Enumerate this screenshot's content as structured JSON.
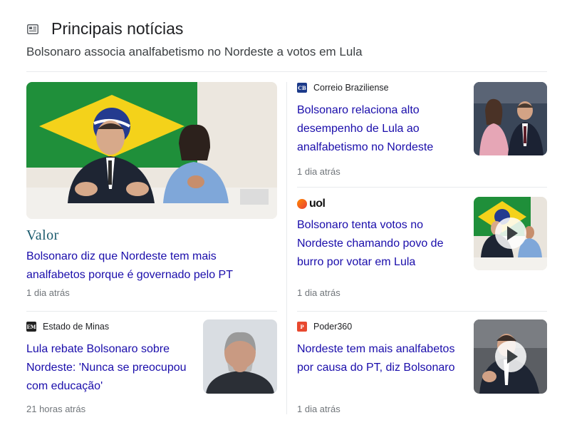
{
  "header": {
    "title": "Principais notícias",
    "subtitle": "Bolsonaro associa analfabetismo no Nordeste a votos em Lula",
    "icon": "newspaper-icon"
  },
  "articles": [
    {
      "source": "Valor",
      "headline": "Bolsonaro diz que Nordeste tem mais analfabetos porque é governado pelo PT",
      "time": "1 dia atrás"
    },
    {
      "source": "Correio Braziliense",
      "logo_text": "CB",
      "logo_color": "#1c3a8a",
      "headline": "Bolsonaro relaciona alto desempenho de Lula ao analfabetismo no Nordeste",
      "time": "1 dia atrás"
    },
    {
      "source": "uol",
      "headline": "Bolsonaro tenta votos no Nordeste chamando povo de burro por votar em Lula",
      "time": "1 dia atrás",
      "has_video": true
    },
    {
      "source": "Estado de Minas",
      "logo_text": "EM",
      "logo_color": "#222222",
      "headline": "Lula rebate Bolsonaro sobre Nordeste: 'Nunca se preocupou com educação'",
      "time": "21 horas atrás"
    },
    {
      "source": "Poder360",
      "logo_text": "P",
      "logo_color": "#e8492f",
      "headline": "Nordeste tem mais analfabetos por causa do PT, diz Bolsonaro",
      "time": "1 dia atrás",
      "has_video": true
    }
  ],
  "colors": {
    "headline": "#1a0dab",
    "time": "#70757a",
    "divider": "#e8eaed"
  }
}
